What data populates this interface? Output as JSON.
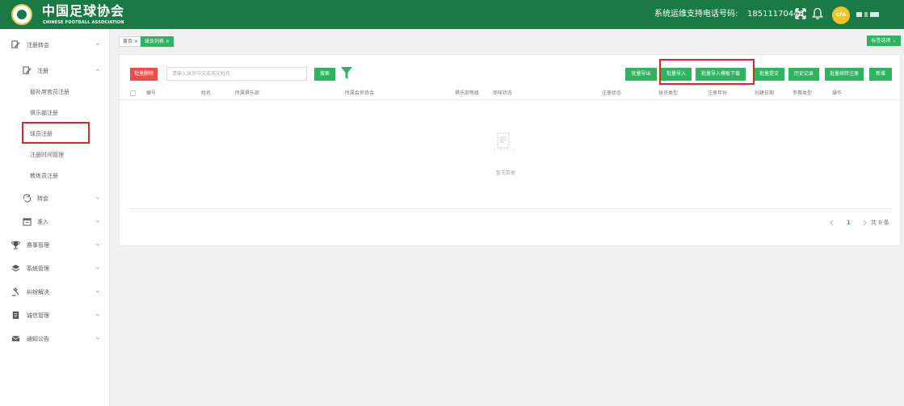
{
  "header": {
    "title_cn": "中国足球协会",
    "title_en": "CHINESE FOOTBALL ASSOCIATION",
    "support_label": "系统运维支持电话号码:",
    "support_phone": "18511170446",
    "badge": "CFA"
  },
  "sidebar": {
    "items": [
      {
        "label": "注册转会"
      },
      {
        "label": "注册"
      },
      {
        "label": "替补席官员注册"
      },
      {
        "label": "俱乐部注册"
      },
      {
        "label": "球员注册"
      },
      {
        "label": "注册时间管理"
      },
      {
        "label": "教练员注册"
      },
      {
        "label": "转会"
      },
      {
        "label": "准入"
      },
      {
        "label": "赛事管理"
      },
      {
        "label": "系统管理"
      },
      {
        "label": "纠纷解决"
      },
      {
        "label": "诚信管理"
      },
      {
        "label": "通知公告"
      }
    ]
  },
  "tabs": [
    {
      "label": "首页"
    },
    {
      "label": "球员列表"
    }
  ],
  "tag_options": "标签选项",
  "toolbar": {
    "batch_delete": "批量删除",
    "search_placeholder": "请输入球员中文或英文姓名",
    "search": "搜索",
    "batch_export": "批量导出",
    "batch_import": "批量导入",
    "import_template": "批量导入模板下载",
    "batch_submit": "批量提交",
    "history": "历史记录",
    "batch_reregister": "批量续转注册",
    "add": "新增"
  },
  "table": {
    "columns": [
      "编号",
      "姓名",
      "所属俱乐部",
      "所属会员协会",
      "俱乐部等级",
      "审核状态",
      "注册状态",
      "球员类型",
      "注册年份",
      "创建日期",
      "参赛类型",
      "操作"
    ],
    "empty_text": "暂无数据"
  },
  "pagination": {
    "current": "1",
    "total_text": "共 0 条"
  },
  "colors": {
    "header": "#1a7a45",
    "accent": "#2eb35f",
    "danger": "#f04a4a",
    "highlight": "#e0242a"
  }
}
